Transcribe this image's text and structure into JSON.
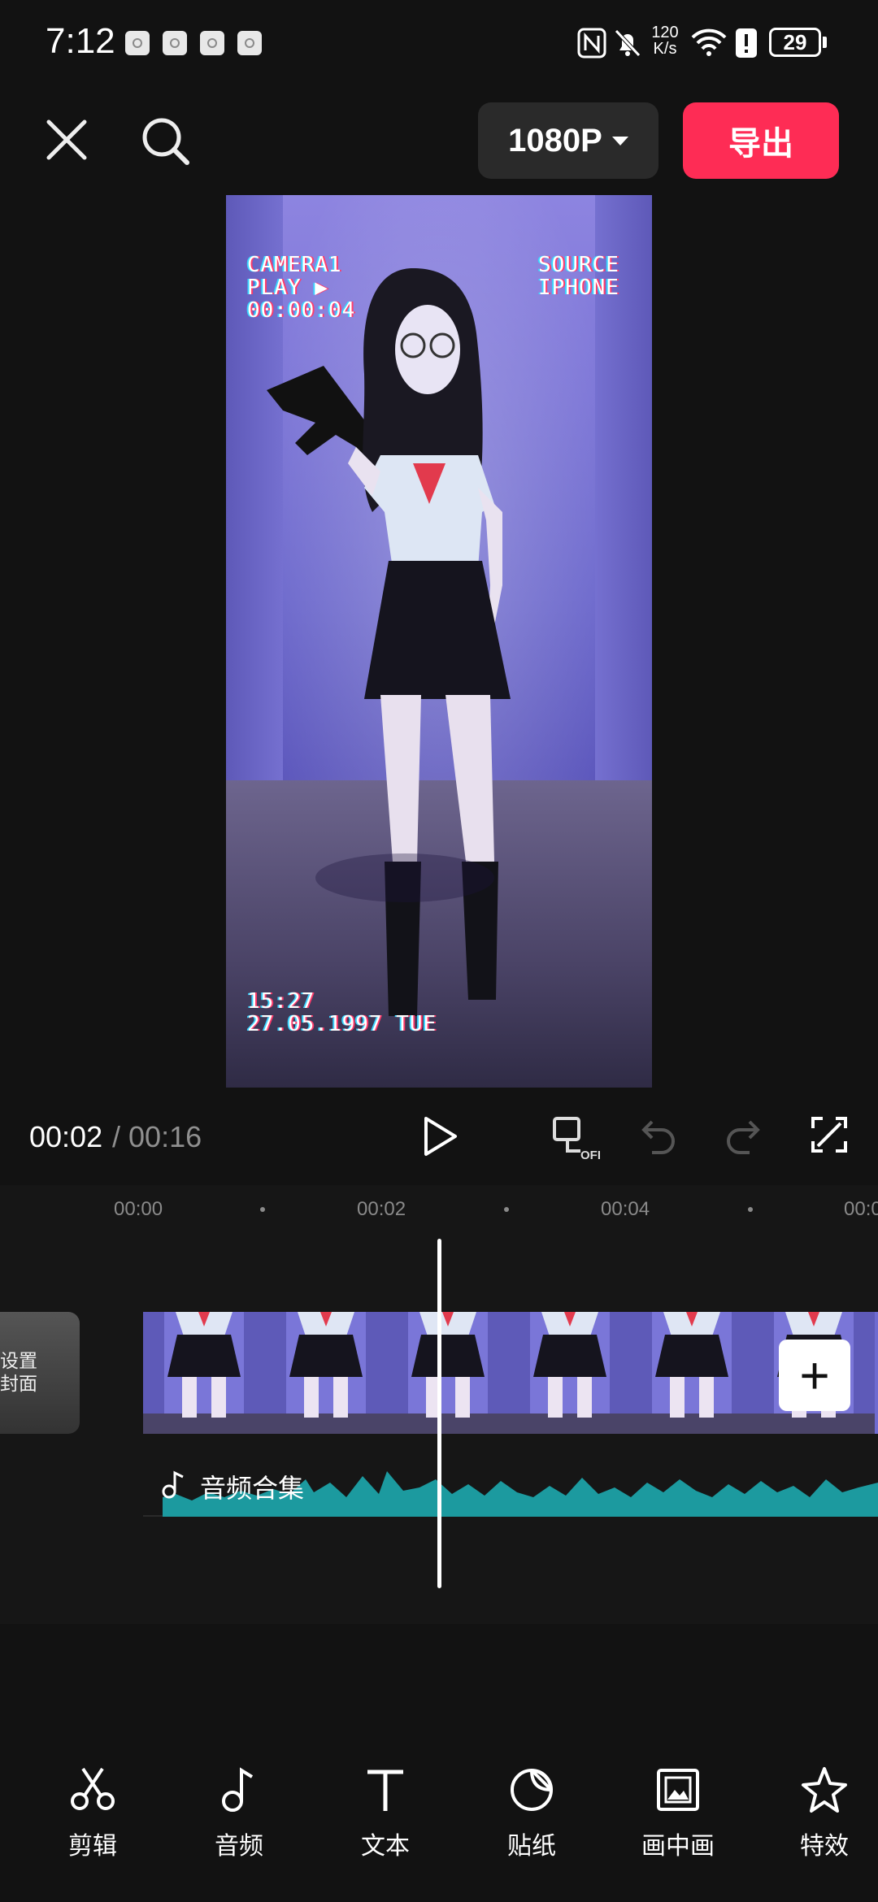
{
  "status_bar": {
    "time": "7:12",
    "net_speed_top": "120",
    "net_speed_bottom": "K/s",
    "battery": "29"
  },
  "top_bar": {
    "resolution": "1080P",
    "export": "导出"
  },
  "preview": {
    "overlay_top_left": [
      "CAMERA1",
      "PLAY ▶",
      "00:00:04"
    ],
    "overlay_top_right": [
      "SOURCE",
      "IPHONE"
    ],
    "overlay_bottom_left": [
      "15:27",
      "27.05.1997 TUE"
    ]
  },
  "playback": {
    "current_time": "00:02",
    "separator": "/",
    "total_time": "00:16"
  },
  "timeline": {
    "ruler": [
      "00:00",
      "00:02",
      "00:04",
      "00:0"
    ],
    "cover_label_line1": "设置",
    "cover_label_line2": "封面",
    "audio_label": "音频合集"
  },
  "toolbar": {
    "items": [
      {
        "label": "剪辑",
        "icon": "scissors-icon"
      },
      {
        "label": "音频",
        "icon": "music-note-icon"
      },
      {
        "label": "文本",
        "icon": "text-icon"
      },
      {
        "label": "贴纸",
        "icon": "sticker-icon"
      },
      {
        "label": "画中画",
        "icon": "picture-in-picture-icon"
      },
      {
        "label": "特效",
        "icon": "effects-star-icon"
      }
    ]
  },
  "colors": {
    "export": "#fe2c55",
    "audio_wave": "#1c9a9f",
    "background": "#121212"
  }
}
